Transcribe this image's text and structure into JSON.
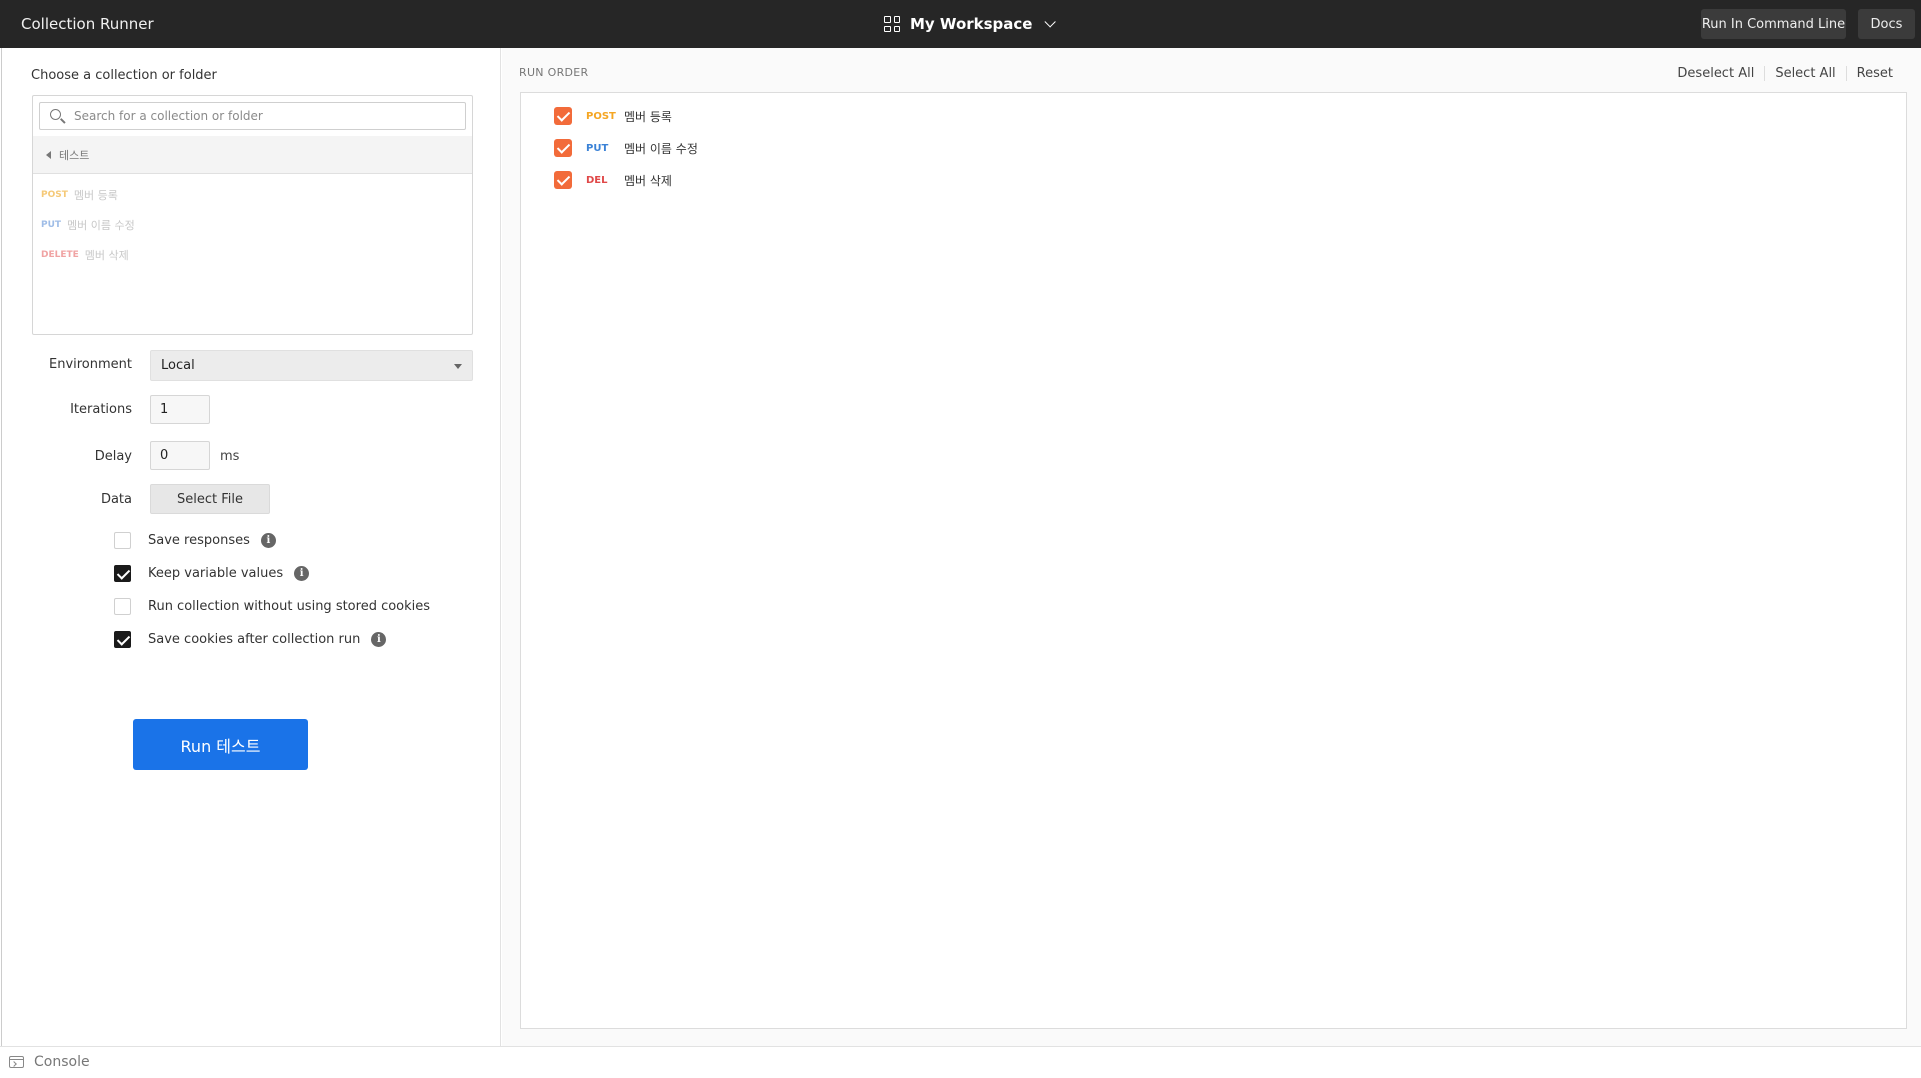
{
  "topbar": {
    "title": "Collection Runner",
    "workspace": "My Workspace",
    "run_cmd": "Run In Command Line",
    "docs": "Docs"
  },
  "left": {
    "choose_label": "Choose a collection or folder",
    "search_placeholder": "Search for a collection or folder",
    "folder_name": "테스트",
    "requests": [
      {
        "method": "POST",
        "name": "멤버 등록"
      },
      {
        "method": "PUT",
        "name": "멤버 이름 수정"
      },
      {
        "method": "DELETE",
        "name": "멤버 삭제"
      }
    ],
    "environment_label": "Environment",
    "environment_value": "Local",
    "iterations_label": "Iterations",
    "iterations_value": "1",
    "delay_label": "Delay",
    "delay_value": "0",
    "delay_unit": "ms",
    "data_label": "Data",
    "select_file": "Select File",
    "options": [
      {
        "label": "Save responses",
        "checked": false,
        "info": true
      },
      {
        "label": "Keep variable values",
        "checked": true,
        "info": true
      },
      {
        "label": "Run collection without using stored cookies",
        "checked": false,
        "info": false
      },
      {
        "label": "Save cookies after collection run",
        "checked": true,
        "info": true
      }
    ],
    "run_button": "Run 테스트"
  },
  "right": {
    "run_order_label": "RUN ORDER",
    "deselect_all": "Deselect All",
    "select_all": "Select All",
    "reset": "Reset",
    "items": [
      {
        "method": "POST",
        "name": "멤버 등록"
      },
      {
        "method": "PUT",
        "name": "멤버 이름 수정"
      },
      {
        "method": "DEL",
        "name": "멤버 삭제"
      }
    ]
  },
  "bottom": {
    "console": "Console"
  },
  "colors": {
    "accent": "#1a73e8",
    "checkbox_orange": "#f26b3a",
    "post": "#f5a623",
    "put": "#3b82d6",
    "delete": "#e04848"
  }
}
